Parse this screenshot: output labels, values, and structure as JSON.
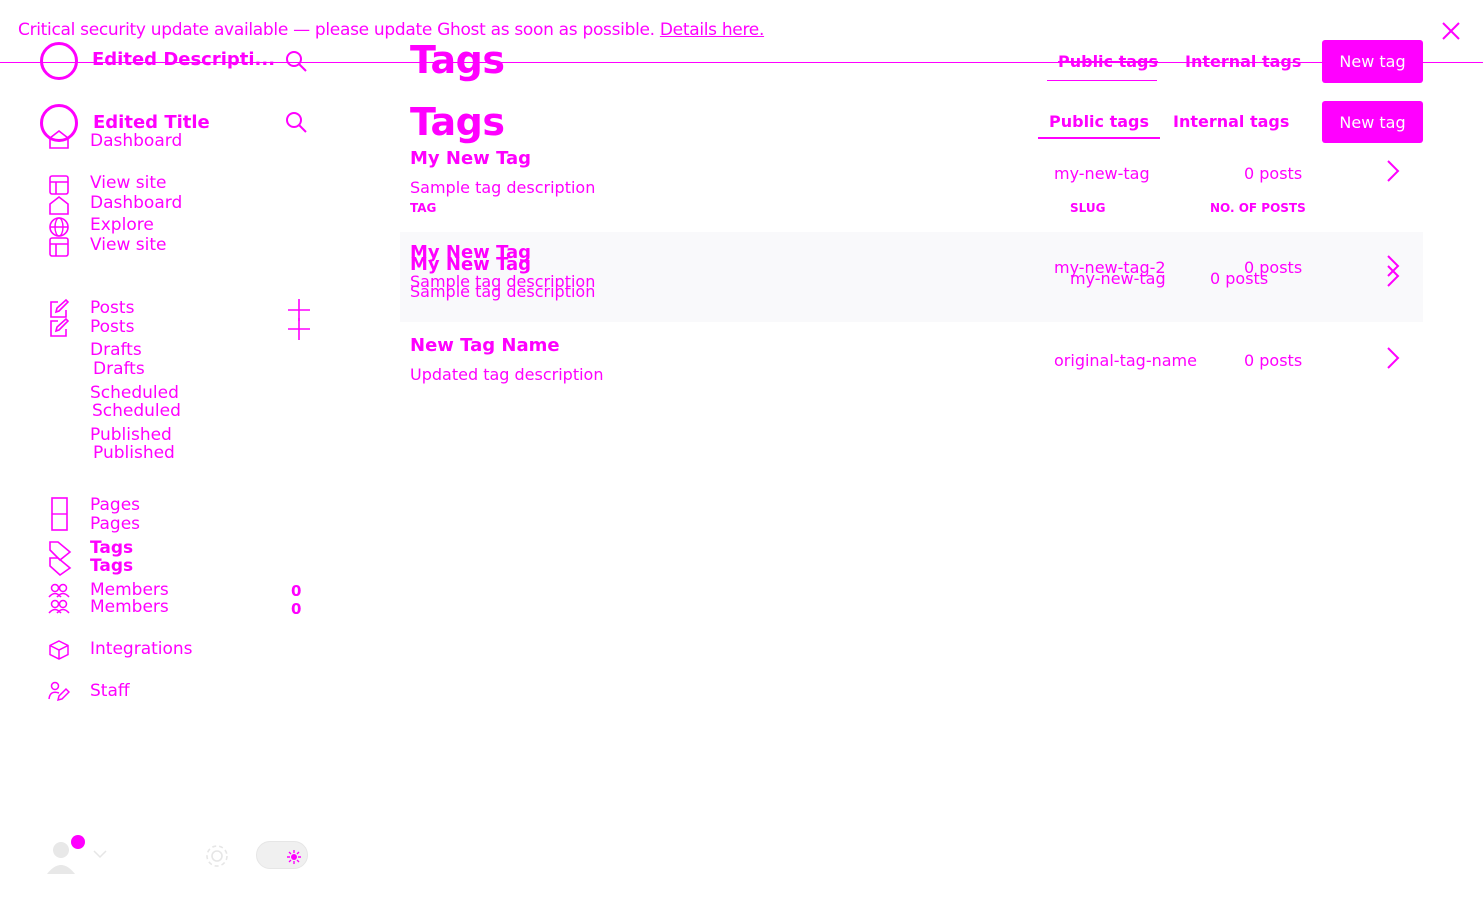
{
  "banner": {
    "text": "Critical security update available — please update Ghost as soon as possible.",
    "link": "Details here.",
    "close_icon": "close-icon"
  },
  "sidebar": {
    "ghost_top": {
      "site_title": "Edited Descripti...",
      "nav_item": "Dashboard"
    },
    "site_title": "Edited Title",
    "items_primary": [
      {
        "label": "View site",
        "icon": "layout-icon"
      },
      {
        "label": "Dashboard",
        "icon": "home-icon"
      },
      {
        "label": "Explore",
        "icon": "globe-icon"
      },
      {
        "label": "View site",
        "icon": "layout-icon"
      }
    ],
    "posts": {
      "label": "Posts",
      "label_ghost": "Posts"
    },
    "posts_sub": [
      {
        "label": "Drafts",
        "ghost": "Drafts"
      },
      {
        "label": "Scheduled",
        "ghost": "Scheduled"
      },
      {
        "label": "Published",
        "ghost": "Published"
      }
    ],
    "pages": {
      "label": "Pages",
      "ghost": "Pages"
    },
    "tags": {
      "label": "Tags",
      "ghost": "Tags"
    },
    "members": {
      "label": "Members",
      "ghost": "Members",
      "count": "0",
      "count_ghost": "0"
    },
    "integrations": {
      "label": "Integrations"
    },
    "staff": {
      "label": "Staff"
    }
  },
  "header": {
    "title": "Tags",
    "title_ghost": "Tags",
    "tabs": [
      {
        "label": "Public tags",
        "active": true
      },
      {
        "label": "Internal tags",
        "active": false
      }
    ],
    "tabs_ghost": [
      {
        "label": "Public tags"
      },
      {
        "label": "Internal tags"
      }
    ],
    "new_button": "New tag",
    "new_button_ghost": "New tag"
  },
  "table": {
    "columns": {
      "tag": "TAG",
      "slug": "SLUG",
      "posts": "NO. OF POSTS"
    },
    "rows": [
      {
        "name": "My New Tag",
        "description": "Sample tag description",
        "slug": "my-new-tag",
        "posts": "0 posts"
      },
      {
        "name": "My New Tag",
        "description": "Sample tag description",
        "slug": "my-new-tag-2",
        "posts": "0 posts"
      },
      {
        "name": "New Tag Name",
        "description": "Updated tag description",
        "slug": "original-tag-name",
        "posts": "0 posts"
      }
    ],
    "ghost_row": {
      "name": "My New Tag",
      "description": "Sample tag description",
      "slug": "my-new-tag",
      "posts": "0 posts"
    }
  },
  "colors": {
    "accent": "#ff00ff"
  }
}
